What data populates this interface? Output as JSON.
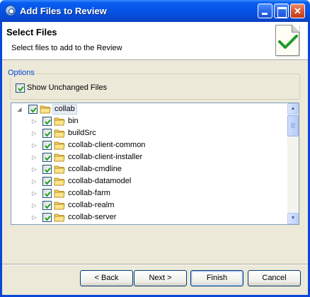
{
  "window": {
    "title": "Add Files to Review",
    "controls": [
      "minimize",
      "maximize",
      "close"
    ]
  },
  "header": {
    "title": "Select Files",
    "description": "Select files to add to the Review",
    "icon": "document-checkmark-icon"
  },
  "options": {
    "legend": "Options",
    "show_unchanged": {
      "label": "Show Unchanged Files",
      "checked": true
    }
  },
  "tree": {
    "root": {
      "label": "collab",
      "checked": true,
      "expanded": true
    },
    "children": [
      {
        "label": "bin",
        "checked": true
      },
      {
        "label": "buildSrc",
        "checked": true
      },
      {
        "label": "ccollab-client-common",
        "checked": true
      },
      {
        "label": "ccollab-client-installer",
        "checked": true
      },
      {
        "label": "ccollab-cmdline",
        "checked": true
      },
      {
        "label": "ccollab-datamodel",
        "checked": true
      },
      {
        "label": "ccollab-farm",
        "checked": true
      },
      {
        "label": "ccollab-realm",
        "checked": true
      },
      {
        "label": "ccollab-server",
        "checked": true
      }
    ]
  },
  "buttons": {
    "back": "< Back",
    "next": "Next >",
    "finish": "Finish",
    "cancel": "Cancel"
  },
  "colors": {
    "titlebar": "#0454e6",
    "dialog_bg": "#ece9d8",
    "legend_text": "#0046d5",
    "check_green": "#21a121",
    "folder_yellow": "#f5d25a"
  }
}
